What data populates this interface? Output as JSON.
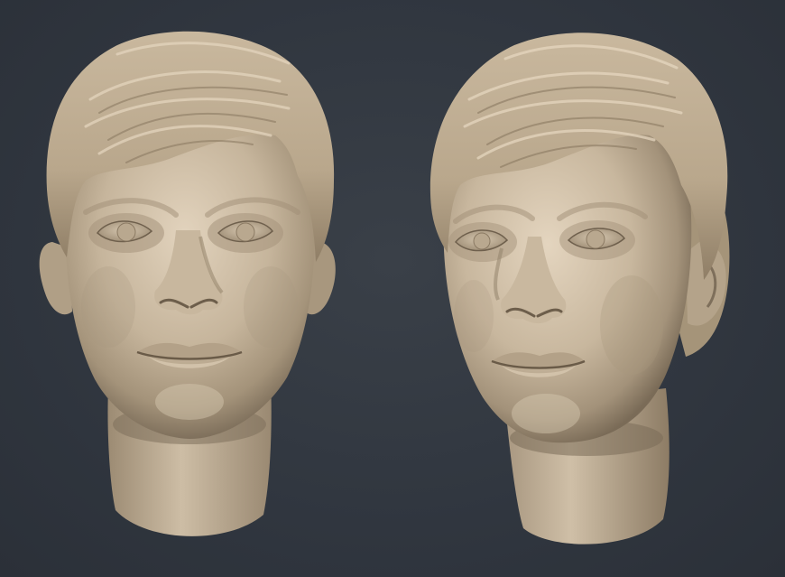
{
  "scene": {
    "background_color": "#30363f",
    "clay_color": "#c8b8a0",
    "clay_shadow_color": "#6e604e",
    "clay_highlight_color": "#e6d8c2",
    "models": [
      {
        "id": "head-front",
        "view": "front"
      },
      {
        "id": "head-three-quarter",
        "view": "three-quarter"
      }
    ]
  }
}
